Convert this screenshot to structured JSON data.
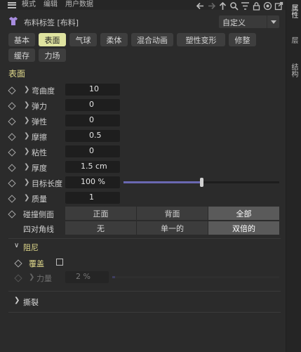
{
  "menu": [
    "模式",
    "编辑",
    "用户数据"
  ],
  "header": {
    "title": "布料标签 [布料]",
    "preset": "自定义"
  },
  "tabs": [
    {
      "label": "基本",
      "active": false
    },
    {
      "label": "表面",
      "active": true
    },
    {
      "label": "气球",
      "active": false
    },
    {
      "label": "柔体",
      "active": false
    },
    {
      "label": "混合动画",
      "active": false
    },
    {
      "label": "塑性变形",
      "active": false
    },
    {
      "label": "修整",
      "active": false
    },
    {
      "label": "缓存",
      "active": false
    },
    {
      "label": "力场",
      "active": false
    }
  ],
  "section": "表面",
  "props": [
    {
      "label": "弯曲度",
      "value": "10"
    },
    {
      "label": "弹力",
      "value": "0"
    },
    {
      "label": "弹性",
      "value": "0"
    },
    {
      "label": "摩擦",
      "value": "0.5"
    },
    {
      "label": "粘性",
      "value": "0"
    },
    {
      "label": "厚度",
      "value": "1.5 cm"
    },
    {
      "label": "目标长度",
      "value": "100 %",
      "slider_fraction": 0.5
    },
    {
      "label": "质量",
      "value": "1"
    }
  ],
  "collision": {
    "label": "碰撞侧面",
    "options": [
      "正面",
      "背面",
      "全部"
    ],
    "selected": "全部"
  },
  "diagonal": {
    "label": "四对角线",
    "options": [
      "无",
      "单一的",
      "双倍的"
    ],
    "selected": "双倍的"
  },
  "damping": {
    "title": "阻尼",
    "override_label": "覆盖",
    "override_checked": false,
    "force_label": "力量",
    "force_value": "2 %"
  },
  "tear": {
    "title": "撕裂"
  },
  "side_tabs": [
    "属性",
    "层",
    "结构"
  ],
  "colors": {
    "accent": "#dfe3a0",
    "slider": "#6a68b2",
    "section": "#e0d98c"
  }
}
